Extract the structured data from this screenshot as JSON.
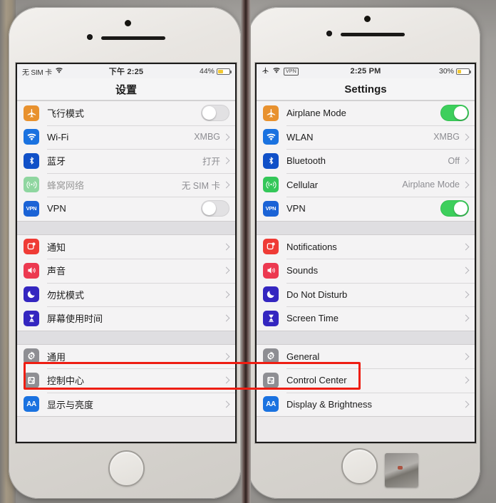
{
  "scene": {
    "description": "Two iPhones side by side showing the iOS Settings app, one in Chinese and one in English, with a red annotation box highlighting the General row",
    "annotation_color": "#ee1d12"
  },
  "phones": [
    {
      "id": "left",
      "language": "zh",
      "status_bar": {
        "carrier": "无 SIM 卡",
        "wifi_icon": "wifi-icon",
        "time": "下午 2:25",
        "battery_percent": "44%",
        "battery_level": 44,
        "battery_color": "#f2c832"
      },
      "nav_title": "设置",
      "groups": [
        {
          "rows": [
            {
              "icon": "airplane-icon",
              "icon_color": "#e8912e",
              "glyph": "✈",
              "label": "飞行模式",
              "control": "toggle",
              "toggle_on": false
            },
            {
              "icon": "wifi-icon",
              "icon_color": "#1a72e0",
              "glyph": "◗",
              "label": "Wi-Fi",
              "control": "value",
              "value": "XMBG"
            },
            {
              "icon": "bluetooth-icon",
              "icon_color": "#1050c8",
              "glyph": "✦",
              "label": "蓝牙",
              "control": "value",
              "value": "打开"
            },
            {
              "icon": "cellular-icon",
              "icon_color": "#8fd6a0",
              "glyph": "((•))",
              "label": "蜂窝网络",
              "label_dim": true,
              "control": "value",
              "value": "无 SIM 卡"
            },
            {
              "icon": "vpn-icon",
              "icon_color": "#1b63d6",
              "glyph": "VPN",
              "label": "VPN",
              "control": "toggle",
              "toggle_on": false
            }
          ]
        },
        {
          "rows": [
            {
              "icon": "notifications-icon",
              "icon_color": "#ef3b35",
              "glyph": "▣",
              "label": "通知",
              "control": "chevron"
            },
            {
              "icon": "sounds-icon",
              "icon_color": "#ec3950",
              "glyph": "◀))",
              "label": "声音",
              "control": "chevron"
            },
            {
              "icon": "do-not-disturb-icon",
              "icon_color": "#3426c0",
              "glyph": "☾",
              "label": "勿扰模式",
              "control": "chevron"
            },
            {
              "icon": "screen-time-icon",
              "icon_color": "#3426c0",
              "glyph": "⌛",
              "label": "屏幕使用时间",
              "control": "chevron"
            }
          ]
        },
        {
          "rows": [
            {
              "icon": "general-gear-icon",
              "icon_color": "#8e8e93",
              "glyph": "⚙",
              "label": "通用",
              "control": "chevron",
              "highlighted": true
            },
            {
              "icon": "control-center-icon",
              "icon_color": "#8e8e93",
              "glyph": "◫",
              "label": "控制中心",
              "control": "chevron"
            },
            {
              "icon": "display-brightness-icon",
              "icon_color": "#1a72e0",
              "glyph": "AA",
              "label": "显示与亮度",
              "control": "chevron"
            }
          ]
        }
      ]
    },
    {
      "id": "right",
      "language": "en",
      "status_bar": {
        "airplane_icon": "airplane-icon",
        "wifi_icon": "wifi-icon",
        "vpn_badge": "VPN",
        "time": "2:25 PM",
        "battery_percent": "30%",
        "battery_level": 30,
        "battery_color": "#f2c832"
      },
      "nav_title": "Settings",
      "groups": [
        {
          "rows": [
            {
              "icon": "airplane-icon",
              "icon_color": "#e8912e",
              "glyph": "✈",
              "label": "Airplane Mode",
              "control": "toggle",
              "toggle_on": true
            },
            {
              "icon": "wifi-icon",
              "icon_color": "#1a72e0",
              "glyph": "◗",
              "label": "WLAN",
              "control": "value",
              "value": "XMBG"
            },
            {
              "icon": "bluetooth-icon",
              "icon_color": "#1050c8",
              "glyph": "✦",
              "label": "Bluetooth",
              "control": "value",
              "value": "Off"
            },
            {
              "icon": "cellular-icon",
              "icon_color": "#34c759",
              "glyph": "((•))",
              "label": "Cellular",
              "control": "value",
              "value": "Airplane Mode"
            },
            {
              "icon": "vpn-icon",
              "icon_color": "#1b63d6",
              "glyph": "VPN",
              "label": "VPN",
              "control": "toggle",
              "toggle_on": true
            }
          ]
        },
        {
          "rows": [
            {
              "icon": "notifications-icon",
              "icon_color": "#ef3b35",
              "glyph": "▣",
              "label": "Notifications",
              "control": "chevron"
            },
            {
              "icon": "sounds-icon",
              "icon_color": "#ec3950",
              "glyph": "◀))",
              "label": "Sounds",
              "control": "chevron"
            },
            {
              "icon": "do-not-disturb-icon",
              "icon_color": "#3426c0",
              "glyph": "☾",
              "label": "Do Not Disturb",
              "control": "chevron"
            },
            {
              "icon": "screen-time-icon",
              "icon_color": "#3426c0",
              "glyph": "⌛",
              "label": "Screen Time",
              "control": "chevron"
            }
          ]
        },
        {
          "rows": [
            {
              "icon": "general-gear-icon",
              "icon_color": "#8e8e93",
              "glyph": "⚙",
              "label": "General",
              "control": "chevron",
              "highlighted": true
            },
            {
              "icon": "control-center-icon",
              "icon_color": "#8e8e93",
              "glyph": "◫",
              "label": "Control Center",
              "control": "chevron"
            },
            {
              "icon": "display-brightness-icon",
              "icon_color": "#1a72e0",
              "glyph": "AA",
              "label": "Display & Brightness",
              "control": "chevron"
            }
          ]
        }
      ]
    }
  ]
}
